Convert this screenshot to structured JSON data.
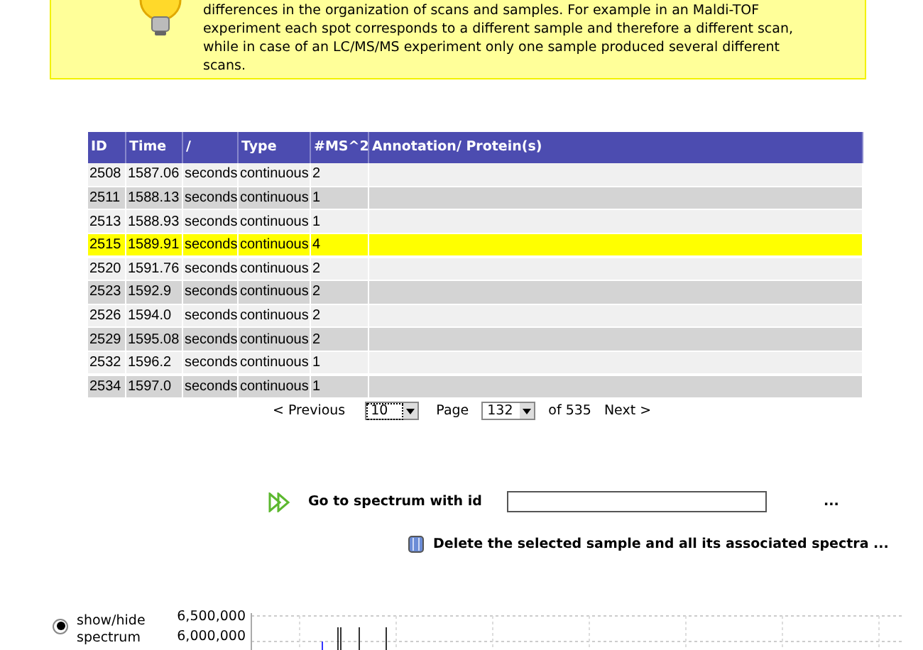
{
  "info_box": {
    "text": "differences in the organization of scans and samples. For example in an Maldi-TOF experiment each spot corresponds to a different sample and therefore a different scan, while in case of an LC/MS/MS experiment only one sample produced several different scans."
  },
  "table": {
    "columns": [
      "ID",
      "Time",
      "/",
      "Type",
      "#MS^2",
      "Annotation/ Protein(s)"
    ],
    "rows": [
      {
        "cells": [
          "2508",
          "1587.06",
          "seconds",
          "continuous",
          "2",
          ""
        ],
        "selected": false
      },
      {
        "cells": [
          "2511",
          "1588.13",
          "seconds",
          "continuous",
          "1",
          ""
        ],
        "selected": false
      },
      {
        "cells": [
          "2513",
          "1588.93",
          "seconds",
          "continuous",
          "1",
          ""
        ],
        "selected": false
      },
      {
        "cells": [
          "2515",
          "1589.91",
          "seconds",
          "continuous",
          "4",
          ""
        ],
        "selected": true
      },
      {
        "cells": [
          "2520",
          "1591.76",
          "seconds",
          "continuous",
          "2",
          ""
        ],
        "selected": false
      },
      {
        "cells": [
          "2523",
          "1592.9",
          "seconds",
          "continuous",
          "2",
          ""
        ],
        "selected": false
      },
      {
        "cells": [
          "2526",
          "1594.0",
          "seconds",
          "continuous",
          "2",
          ""
        ],
        "selected": false
      },
      {
        "cells": [
          "2529",
          "1595.08",
          "seconds",
          "continuous",
          "2",
          ""
        ],
        "selected": false
      },
      {
        "cells": [
          "2532",
          "1596.2",
          "seconds",
          "continuous",
          "1",
          ""
        ],
        "selected": false
      },
      {
        "cells": [
          "2534",
          "1597.0",
          "seconds",
          "continuous",
          "1",
          ""
        ],
        "selected": false
      }
    ]
  },
  "pagination": {
    "previous": "< Previous",
    "page_size": "10",
    "page_label": "Page",
    "page": "132",
    "of": "of 535",
    "next": "Next >"
  },
  "goto": {
    "label": "Go to spectrum with id",
    "more": "..."
  },
  "delete_link": "Delete the selected sample and all its associated spectra ...",
  "spectrum": {
    "toggle_label": "show/hide spectrum",
    "toggle_selected": true,
    "y_tick_labels": [
      "6,500,000",
      "6,000,000"
    ]
  }
}
